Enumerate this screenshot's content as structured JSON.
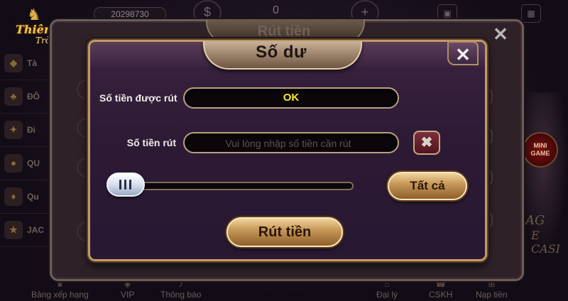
{
  "background": {
    "logo_line1": "Thiên Đường",
    "logo_line2": "Trò Chơi",
    "balance": "20298730",
    "top_value": "0",
    "back_dialog_title": "Rút tiền",
    "back_close": "✕",
    "side_items": [
      "Tà",
      "ĐÔ",
      "Đi",
      "QU",
      "Qu",
      "JAC"
    ],
    "mini_game_line1": "MINI",
    "mini_game_line2": "GAME",
    "deco_text1": "AG",
    "deco_text2": "E CASI",
    "bottom_nav": [
      "Bảng xếp hạng",
      "VIP",
      "Thông báo",
      "Đại lý",
      "CSKH",
      "Nạp tiền"
    ]
  },
  "dialog": {
    "title": "Số dư",
    "close": "✕",
    "withdrawable_label": "Số tiền được rút",
    "withdrawable_value": "OK",
    "amount_label": "Số tiền rút",
    "amount_placeholder": "Vui lòng nhập số tiền cần rút",
    "amount_value": "",
    "clear_icon": "✖",
    "slider_value_percent": 0,
    "all_button": "Tất cả",
    "withdraw_button": "Rút tiền"
  },
  "colors": {
    "accent_gold": "#c29a66",
    "value_yellow": "#f3ea2a",
    "panel_purple": "#2d1a35"
  }
}
